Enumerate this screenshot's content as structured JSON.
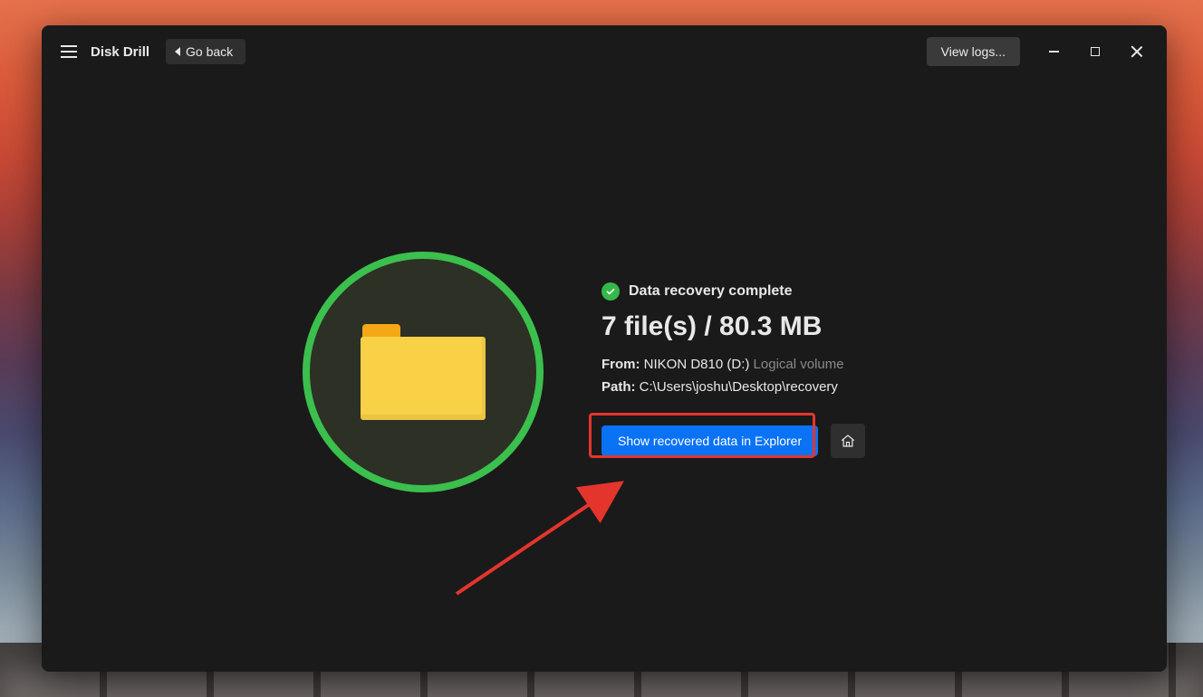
{
  "titlebar": {
    "app_name": "Disk Drill",
    "go_back_label": "Go back",
    "view_logs_label": "View logs..."
  },
  "status": {
    "label": "Data recovery complete"
  },
  "summary": {
    "headline": "7 file(s) / 80.3 MB",
    "from_label": "From:",
    "from_value": "NIKON D810 (D:)",
    "from_suffix": "Logical volume",
    "path_label": "Path:",
    "path_value": "C:\\Users\\joshu\\Desktop\\recovery"
  },
  "actions": {
    "show_in_explorer": "Show recovered data in Explorer"
  },
  "colors": {
    "accent_green": "#3bbf4d",
    "primary_blue": "#0a72f5",
    "highlight_red": "#e4352d"
  }
}
